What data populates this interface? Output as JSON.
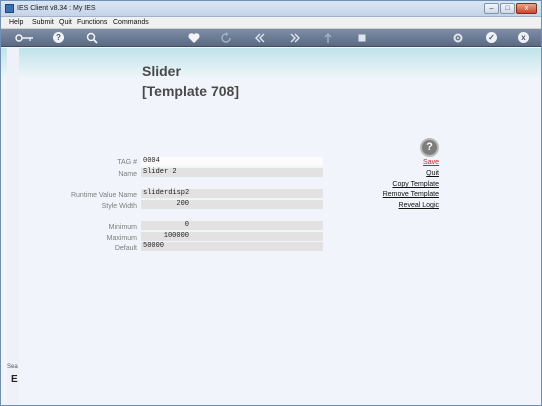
{
  "window": {
    "title": "IES Client v8.34 : My IES"
  },
  "window_buttons": {
    "minimize": "–",
    "maximize": "□",
    "close": "x"
  },
  "menu": {
    "items": [
      "Help",
      "Submit",
      "Quit",
      "Functions",
      "Commands"
    ]
  },
  "toolbar": {
    "icons": [
      "key-icon",
      "help-icon",
      "search-icon",
      "heart-icon",
      "refresh-icon",
      "rewind-icon",
      "fast-forward-icon",
      "upload-icon",
      "stop-icon",
      "settings-icon",
      "check-icon",
      "close-icon"
    ],
    "help_glyph": "?",
    "check_glyph": "✓",
    "close_glyph": "x"
  },
  "form": {
    "title": "Slider",
    "subtitle": "[Template 708]",
    "fields": [
      {
        "label": "TAG #",
        "value": "0004"
      },
      {
        "label": "Name",
        "value": "Slider 2"
      },
      {
        "label": "Runtime Value Name",
        "value": "sliderdisp2"
      },
      {
        "label": "Style Width",
        "value": "200"
      },
      {
        "label": "Minimum",
        "value": "0"
      },
      {
        "label": "Maximum",
        "value": "100000"
      },
      {
        "label": "Default",
        "value": "50000"
      }
    ]
  },
  "help_glyph": "?",
  "actions": {
    "save": "Save",
    "quit": "Quit",
    "copy_template": "Copy Template",
    "remove_template": "Remove Template",
    "reveal_logic": "Reveal Logic"
  },
  "side": {
    "text": "Sea",
    "mark": "E"
  },
  "colors": {
    "toolbar": "#6b7a93",
    "band": "#c4e5ec",
    "save_link": "#cc1f1f"
  }
}
